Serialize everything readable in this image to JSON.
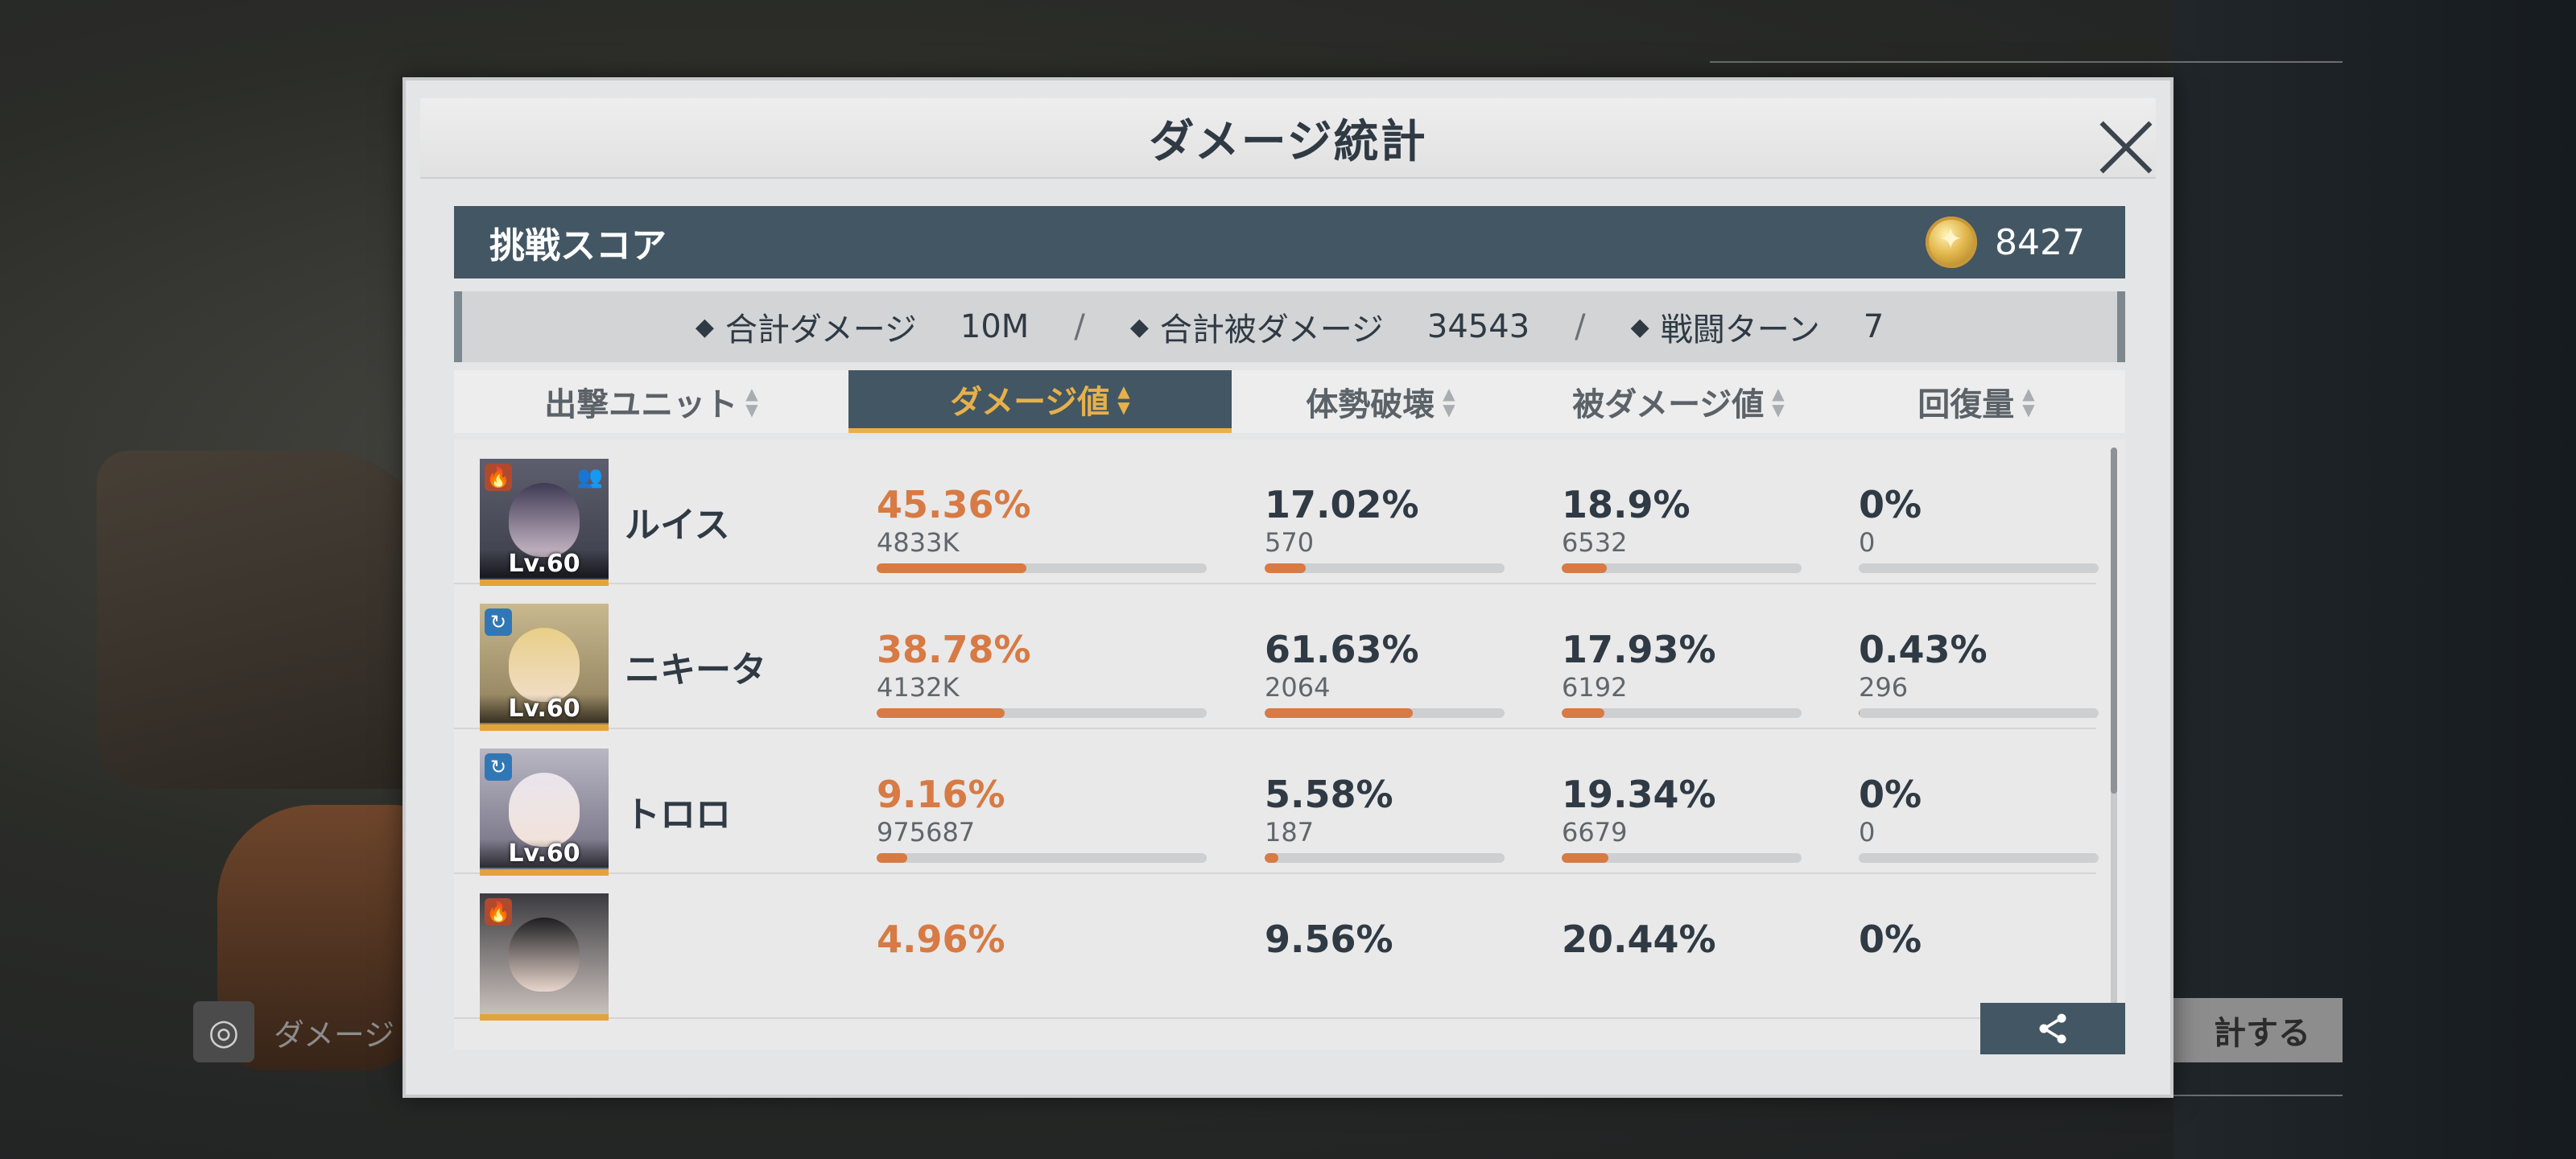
{
  "modal": {
    "title": "ダメージ統計"
  },
  "score": {
    "label": "挑戦スコア",
    "value": "8427"
  },
  "totals": {
    "total_damage_label": "合計ダメージ",
    "total_damage_value": "10M",
    "damage_taken_label": "合計被ダメージ",
    "damage_taken_value": "34543",
    "turns_label": "戦闘ターン",
    "turns_value": "7",
    "separator": "/"
  },
  "columns": [
    "出撃ユニット",
    "ダメージ値",
    "体勢破壊",
    "被ダメージ値",
    "回復量"
  ],
  "active_column_index": 1,
  "units": [
    {
      "name": "ルイス",
      "level": "Lv.60",
      "element_icon": "fire-element-icon",
      "extra_icon": "group-icon",
      "damage": {
        "pct": "45.36%",
        "abs": "4833K",
        "fraction": 0.4536
      },
      "break": {
        "pct": "17.02%",
        "abs": "570",
        "fraction": 0.1702
      },
      "taken": {
        "pct": "18.9%",
        "abs": "6532",
        "fraction": 0.189
      },
      "heal": {
        "pct": "0%",
        "abs": "0",
        "fraction": 0
      }
    },
    {
      "name": "ニキータ",
      "level": "Lv.60",
      "element_icon": "cycle-element-icon",
      "damage": {
        "pct": "38.78%",
        "abs": "4132K",
        "fraction": 0.3878
      },
      "break": {
        "pct": "61.63%",
        "abs": "2064",
        "fraction": 0.6163
      },
      "taken": {
        "pct": "17.93%",
        "abs": "6192",
        "fraction": 0.1793
      },
      "heal": {
        "pct": "0.43%",
        "abs": "296",
        "fraction": 0.0043
      }
    },
    {
      "name": "トロロ",
      "level": "Lv.60",
      "element_icon": "cycle-element-icon",
      "damage": {
        "pct": "9.16%",
        "abs": "975687",
        "fraction": 0.0916
      },
      "break": {
        "pct": "5.58%",
        "abs": "187",
        "fraction": 0.0558
      },
      "taken": {
        "pct": "19.34%",
        "abs": "6679",
        "fraction": 0.1934
      },
      "heal": {
        "pct": "0%",
        "abs": "0",
        "fraction": 0
      }
    },
    {
      "name": "",
      "level": "",
      "element_icon": "fire-element-icon",
      "damage": {
        "pct": "4.96%"
      },
      "break": {
        "pct": "9.56%"
      },
      "taken": {
        "pct": "20.44%"
      },
      "heal": {
        "pct": "0%"
      }
    }
  ],
  "background": {
    "left_button_label": "ダメージ",
    "right_button_label": "計する"
  },
  "colors": {
    "accent": "#d77a44",
    "header": "#435664",
    "active_tab_text": "#e6b14a"
  }
}
